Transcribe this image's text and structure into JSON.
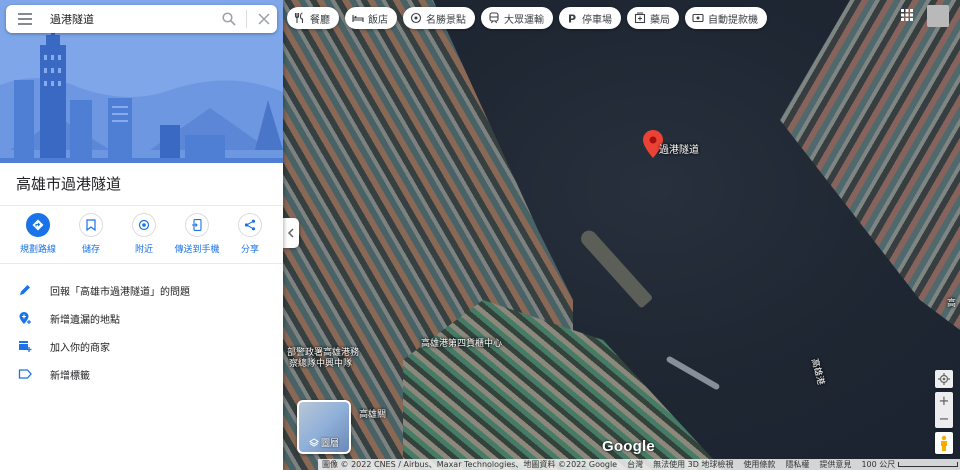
{
  "search": {
    "query": "過港隧道"
  },
  "place": {
    "title": "高雄市過港隧道"
  },
  "actions": [
    {
      "label": "規劃路線",
      "icon": "directions-icon"
    },
    {
      "label": "儲存",
      "icon": "bookmark-icon"
    },
    {
      "label": "附近",
      "icon": "nearby-icon"
    },
    {
      "label": "傳送到手機",
      "icon": "send-to-phone-icon"
    },
    {
      "label": "分享",
      "icon": "share-icon"
    }
  ],
  "menu": [
    {
      "label": "回報「高雄市過港隧道」的問題",
      "icon": "edit-pencil-icon"
    },
    {
      "label": "新增遺漏的地點",
      "icon": "add-location-icon"
    },
    {
      "label": "加入你的商家",
      "icon": "add-business-icon"
    },
    {
      "label": "新增標籤",
      "icon": "label-icon"
    }
  ],
  "chips": [
    {
      "label": "餐廳",
      "icon": "restaurant-icon"
    },
    {
      "label": "飯店",
      "icon": "hotel-icon"
    },
    {
      "label": "名勝景點",
      "icon": "attractions-icon"
    },
    {
      "label": "大眾運輸",
      "icon": "transit-icon"
    },
    {
      "label": "停車場",
      "icon": "parking-icon"
    },
    {
      "label": "藥局",
      "icon": "pharmacy-icon"
    },
    {
      "label": "自動提款機",
      "icon": "atm-icon"
    }
  ],
  "map": {
    "marker_label": "過港隧道",
    "labels": {
      "cargo_center": "高雄港第四貨櫃中心",
      "police": "部警政署高雄港務",
      "police2": "察總隊中興中隊",
      "harbor": "高雄港",
      "customs": "高雄關",
      "right_edge": "高"
    },
    "layers_label": "圖層",
    "google_logo": "Google",
    "attribution": [
      "圖像 © 2022 CNES / Airbus、Maxar Technologies、地圖資料 ©2022 Google",
      "台灣",
      "無法使用 3D 地球檢視",
      "使用條款",
      "隱私權",
      "提供意見"
    ],
    "scale": "100 公尺"
  },
  "colors": {
    "accent": "#1a73e8",
    "marker": "#ea4335",
    "hero_bg": "#7ea6e9"
  }
}
